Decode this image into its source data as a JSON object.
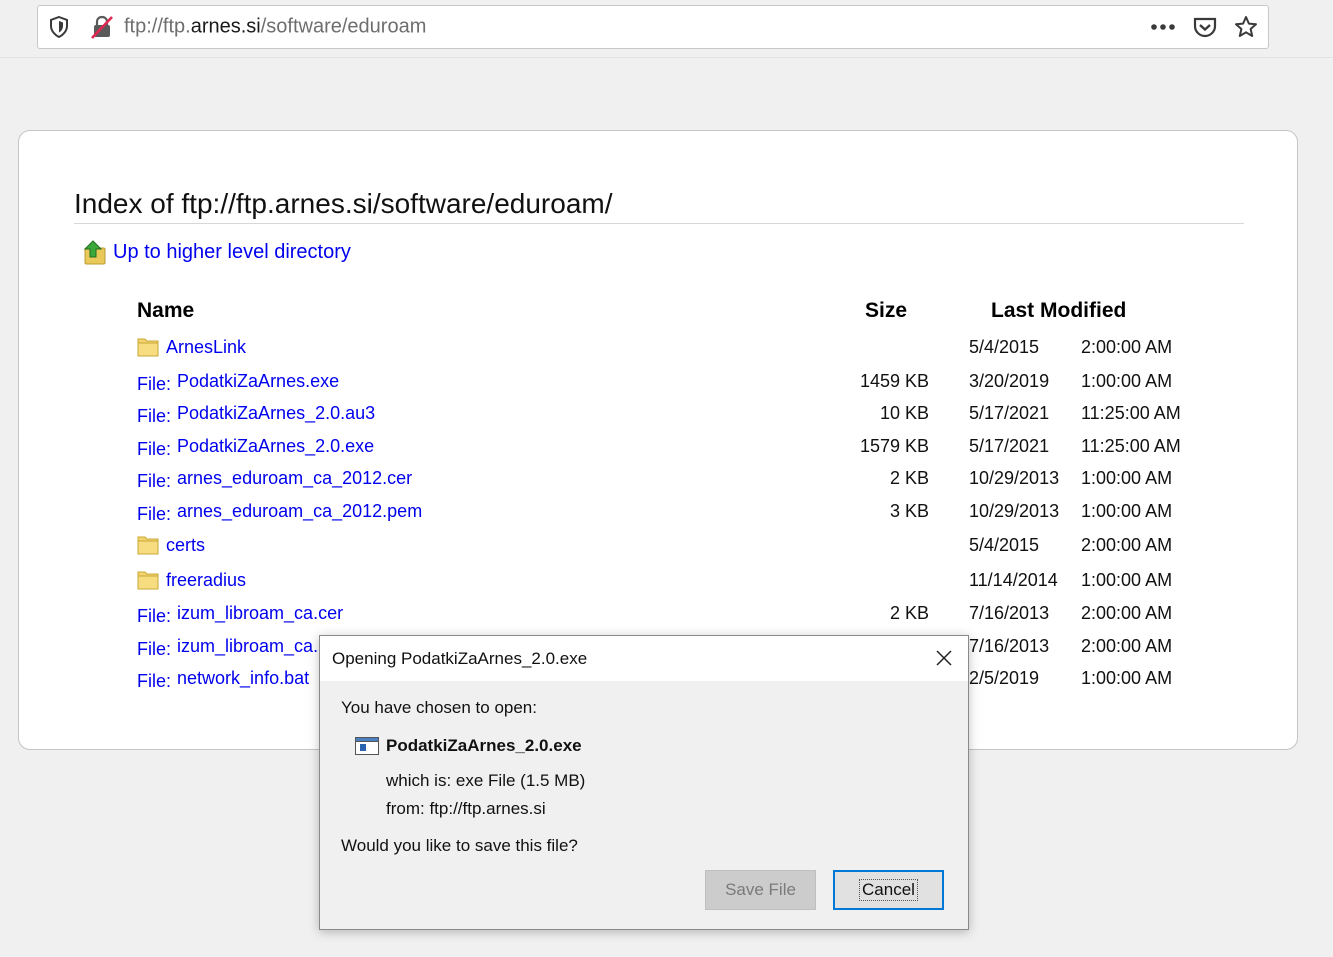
{
  "browser": {
    "url_prefix": "ftp://ftp.",
    "url_host": "arnes.si",
    "url_path": "/software/eduroam",
    "icons": [
      "shield-icon",
      "insecure-lock-icon",
      "more-icon",
      "pocket-icon",
      "bookmark-star-icon"
    ]
  },
  "index": {
    "title": "Index of ftp://ftp.arnes.si/software/eduroam/",
    "up_link": "Up to higher level directory",
    "headers": {
      "name": "Name",
      "size": "Size",
      "modified": "Last Modified"
    },
    "file_prefix": "File:",
    "rows": [
      {
        "type": "folder",
        "name": "ArnesLink",
        "size": "",
        "date": "5/4/2015",
        "time": "2:00:00 AM"
      },
      {
        "type": "file",
        "name": "PodatkiZaArnes.exe",
        "size": "1459 KB",
        "date": "3/20/2019",
        "time": "1:00:00 AM"
      },
      {
        "type": "file",
        "name": "PodatkiZaArnes_2.0.au3",
        "size": "10 KB",
        "date": "5/17/2021",
        "time": "11:25:00 AM"
      },
      {
        "type": "file",
        "name": "PodatkiZaArnes_2.0.exe",
        "size": "1579 KB",
        "date": "5/17/2021",
        "time": "11:25:00 AM"
      },
      {
        "type": "file",
        "name": "arnes_eduroam_ca_2012.cer",
        "size": "2 KB",
        "date": "10/29/2013",
        "time": "1:00:00 AM"
      },
      {
        "type": "file",
        "name": "arnes_eduroam_ca_2012.pem",
        "size": "3 KB",
        "date": "10/29/2013",
        "time": "1:00:00 AM"
      },
      {
        "type": "folder",
        "name": "certs",
        "size": "",
        "date": "5/4/2015",
        "time": "2:00:00 AM"
      },
      {
        "type": "folder",
        "name": "freeradius",
        "size": "",
        "date": "11/14/2014",
        "time": "1:00:00 AM"
      },
      {
        "type": "file",
        "name": "izum_libroam_ca.cer",
        "size": "2 KB",
        "date": "7/16/2013",
        "time": "2:00:00 AM"
      },
      {
        "type": "file",
        "name": "izum_libroam_ca.p",
        "size": "",
        "date": "7/16/2013",
        "time": "2:00:00 AM"
      },
      {
        "type": "file",
        "name": "network_info.bat",
        "size": "",
        "date": "2/5/2019",
        "time": "1:00:00 AM"
      }
    ]
  },
  "dialog": {
    "title": "Opening PodatkiZaArnes_2.0.exe",
    "chosen_label": "You have chosen to open:",
    "filename": "PodatkiZaArnes_2.0.exe",
    "which_is": "which is:  exe File (1.5 MB)",
    "from": "from:  ftp://ftp.arnes.si",
    "question": "Would you like to save this file?",
    "save_label": "Save File",
    "cancel_label": "Cancel"
  }
}
